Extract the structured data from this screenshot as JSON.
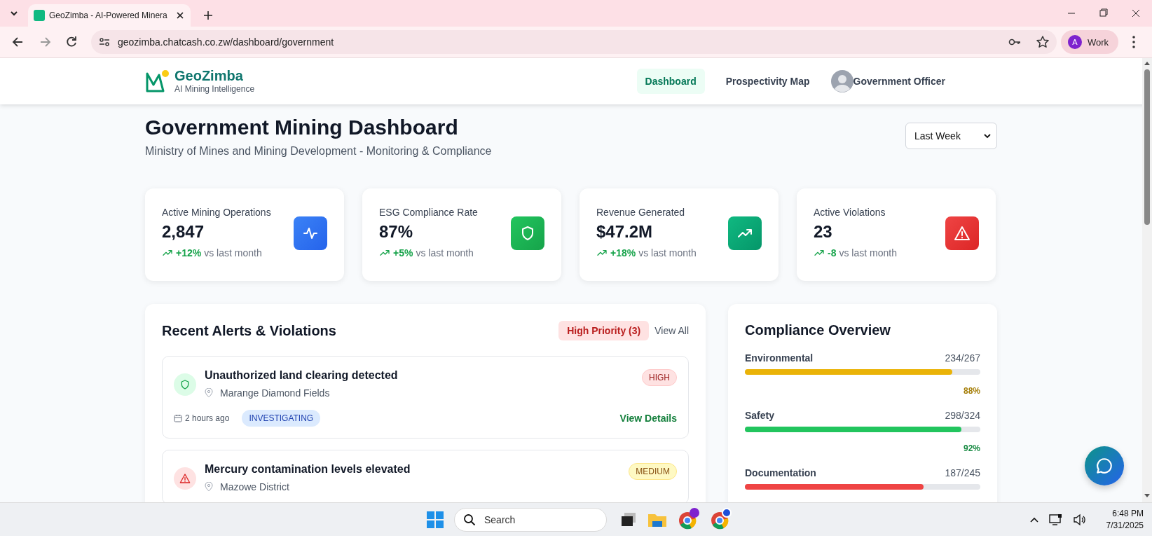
{
  "browser": {
    "tab_title": "GeoZimba - AI-Powered Minera",
    "url": "geozimba.chatcash.co.zw/dashboard/government",
    "profile": {
      "initial": "A",
      "label": "Work"
    }
  },
  "header": {
    "brand": "GeoZimba",
    "tagline": "AI Mining Intelligence",
    "nav": [
      {
        "label": "Dashboard",
        "selected": true
      },
      {
        "label": "Prospectivity Map",
        "selected": false
      }
    ],
    "user": "Government Officer"
  },
  "page": {
    "title": "Government Mining Dashboard",
    "subtitle": "Ministry of Mines and Mining Development - Monitoring & Compliance",
    "period_select": "Last Week"
  },
  "stats": [
    {
      "label": "Active Mining Operations",
      "value": "2,847",
      "change": "+12%",
      "suffix": "vs last month",
      "kind": "activity"
    },
    {
      "label": "ESG Compliance Rate",
      "value": "87%",
      "change": "+5%",
      "suffix": "vs last month",
      "kind": "shield"
    },
    {
      "label": "Revenue Generated",
      "value": "$47.2M",
      "change": "+18%",
      "suffix": "vs last month",
      "kind": "trend"
    },
    {
      "label": "Active Violations",
      "value": "23",
      "change": "-8",
      "suffix": "vs last month",
      "kind": "warning"
    }
  ],
  "alerts": {
    "title": "Recent Alerts & Violations",
    "filter_badge": "High Priority (3)",
    "view_all": "View All",
    "items": [
      {
        "kind": "shield",
        "title": "Unauthorized land clearing detected",
        "location": "Marange Diamond Fields",
        "time": "2 hours ago",
        "status": {
          "label": "INVESTIGATING",
          "kind": "info"
        },
        "severity": {
          "label": "HIGH",
          "kind": "high"
        },
        "action": "View Details"
      },
      {
        "kind": "warning",
        "title": "Mercury contamination levels elevated",
        "location": "Mazowe District",
        "severity": {
          "label": "MEDIUM",
          "kind": "medium"
        }
      }
    ]
  },
  "compliance": {
    "title": "Compliance Overview",
    "items": [
      {
        "name": "Environmental",
        "count": "234/267",
        "level": 0.88,
        "percent": "88%",
        "color": "#eab308"
      },
      {
        "name": "Safety",
        "count": "298/324",
        "level": 0.92,
        "percent": "92%",
        "color": "#22c55e"
      },
      {
        "name": "Documentation",
        "count": "187/245",
        "level": 0.76,
        "color": "#ef4444"
      }
    ]
  },
  "taskbar": {
    "search_placeholder": "Search",
    "time": "6:48 PM",
    "date": "7/31/2025"
  }
}
